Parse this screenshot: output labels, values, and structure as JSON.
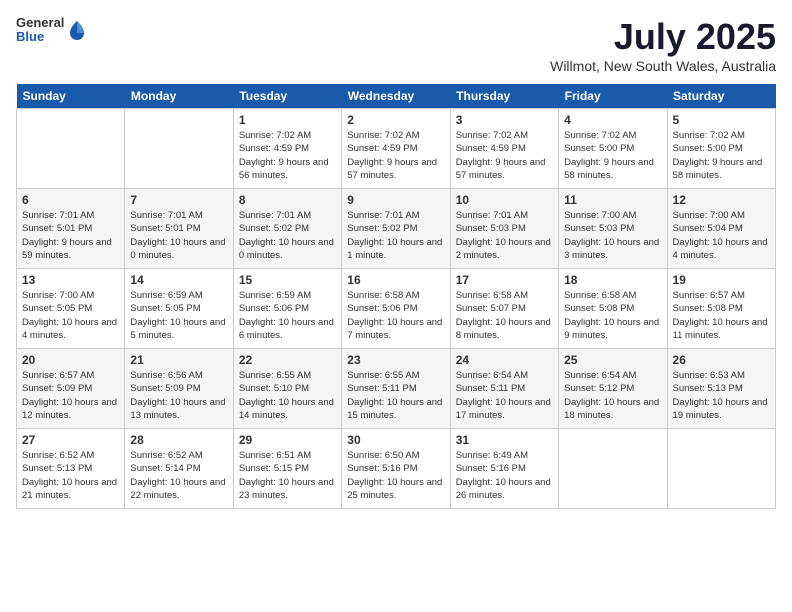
{
  "header": {
    "logo": {
      "general": "General",
      "blue": "Blue"
    },
    "title": "July 2025",
    "location": "Willmot, New South Wales, Australia"
  },
  "days_of_week": [
    "Sunday",
    "Monday",
    "Tuesday",
    "Wednesday",
    "Thursday",
    "Friday",
    "Saturday"
  ],
  "weeks": [
    [
      {
        "day": null
      },
      {
        "day": null
      },
      {
        "day": "1",
        "sunrise": "7:02 AM",
        "sunset": "4:59 PM",
        "daylight": "9 hours and 56 minutes."
      },
      {
        "day": "2",
        "sunrise": "7:02 AM",
        "sunset": "4:59 PM",
        "daylight": "9 hours and 57 minutes."
      },
      {
        "day": "3",
        "sunrise": "7:02 AM",
        "sunset": "4:59 PM",
        "daylight": "9 hours and 57 minutes."
      },
      {
        "day": "4",
        "sunrise": "7:02 AM",
        "sunset": "5:00 PM",
        "daylight": "9 hours and 58 minutes."
      },
      {
        "day": "5",
        "sunrise": "7:02 AM",
        "sunset": "5:00 PM",
        "daylight": "9 hours and 58 minutes."
      }
    ],
    [
      {
        "day": "6",
        "sunrise": "7:01 AM",
        "sunset": "5:01 PM",
        "daylight": "9 hours and 59 minutes."
      },
      {
        "day": "7",
        "sunrise": "7:01 AM",
        "sunset": "5:01 PM",
        "daylight": "10 hours and 0 minutes."
      },
      {
        "day": "8",
        "sunrise": "7:01 AM",
        "sunset": "5:02 PM",
        "daylight": "10 hours and 0 minutes."
      },
      {
        "day": "9",
        "sunrise": "7:01 AM",
        "sunset": "5:02 PM",
        "daylight": "10 hours and 1 minute."
      },
      {
        "day": "10",
        "sunrise": "7:01 AM",
        "sunset": "5:03 PM",
        "daylight": "10 hours and 2 minutes."
      },
      {
        "day": "11",
        "sunrise": "7:00 AM",
        "sunset": "5:03 PM",
        "daylight": "10 hours and 3 minutes."
      },
      {
        "day": "12",
        "sunrise": "7:00 AM",
        "sunset": "5:04 PM",
        "daylight": "10 hours and 4 minutes."
      }
    ],
    [
      {
        "day": "13",
        "sunrise": "7:00 AM",
        "sunset": "5:05 PM",
        "daylight": "10 hours and 4 minutes."
      },
      {
        "day": "14",
        "sunrise": "6:59 AM",
        "sunset": "5:05 PM",
        "daylight": "10 hours and 5 minutes."
      },
      {
        "day": "15",
        "sunrise": "6:59 AM",
        "sunset": "5:06 PM",
        "daylight": "10 hours and 6 minutes."
      },
      {
        "day": "16",
        "sunrise": "6:58 AM",
        "sunset": "5:06 PM",
        "daylight": "10 hours and 7 minutes."
      },
      {
        "day": "17",
        "sunrise": "6:58 AM",
        "sunset": "5:07 PM",
        "daylight": "10 hours and 8 minutes."
      },
      {
        "day": "18",
        "sunrise": "6:58 AM",
        "sunset": "5:08 PM",
        "daylight": "10 hours and 9 minutes."
      },
      {
        "day": "19",
        "sunrise": "6:57 AM",
        "sunset": "5:08 PM",
        "daylight": "10 hours and 11 minutes."
      }
    ],
    [
      {
        "day": "20",
        "sunrise": "6:57 AM",
        "sunset": "5:09 PM",
        "daylight": "10 hours and 12 minutes."
      },
      {
        "day": "21",
        "sunrise": "6:56 AM",
        "sunset": "5:09 PM",
        "daylight": "10 hours and 13 minutes."
      },
      {
        "day": "22",
        "sunrise": "6:55 AM",
        "sunset": "5:10 PM",
        "daylight": "10 hours and 14 minutes."
      },
      {
        "day": "23",
        "sunrise": "6:55 AM",
        "sunset": "5:11 PM",
        "daylight": "10 hours and 15 minutes."
      },
      {
        "day": "24",
        "sunrise": "6:54 AM",
        "sunset": "5:11 PM",
        "daylight": "10 hours and 17 minutes."
      },
      {
        "day": "25",
        "sunrise": "6:54 AM",
        "sunset": "5:12 PM",
        "daylight": "10 hours and 18 minutes."
      },
      {
        "day": "26",
        "sunrise": "6:53 AM",
        "sunset": "5:13 PM",
        "daylight": "10 hours and 19 minutes."
      }
    ],
    [
      {
        "day": "27",
        "sunrise": "6:52 AM",
        "sunset": "5:13 PM",
        "daylight": "10 hours and 21 minutes."
      },
      {
        "day": "28",
        "sunrise": "6:52 AM",
        "sunset": "5:14 PM",
        "daylight": "10 hours and 22 minutes."
      },
      {
        "day": "29",
        "sunrise": "6:51 AM",
        "sunset": "5:15 PM",
        "daylight": "10 hours and 23 minutes."
      },
      {
        "day": "30",
        "sunrise": "6:50 AM",
        "sunset": "5:16 PM",
        "daylight": "10 hours and 25 minutes."
      },
      {
        "day": "31",
        "sunrise": "6:49 AM",
        "sunset": "5:16 PM",
        "daylight": "10 hours and 26 minutes."
      },
      {
        "day": null
      },
      {
        "day": null
      }
    ]
  ]
}
